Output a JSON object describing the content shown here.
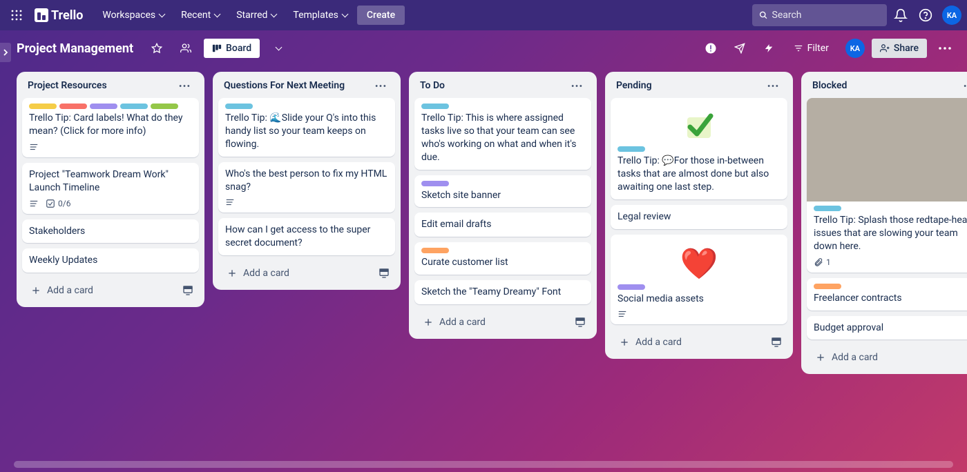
{
  "brand": "Trello",
  "nav": {
    "workspaces": "Workspaces",
    "recent": "Recent",
    "starred": "Starred",
    "templates": "Templates",
    "create": "Create"
  },
  "search_placeholder": "Search",
  "user_initials": "KA",
  "board": {
    "title": "Project Management",
    "view_label": "Board",
    "filter": "Filter",
    "share": "Share"
  },
  "colors": {
    "yellow": "#f5cd47",
    "red": "#f87168",
    "purple": "#9f8fef",
    "sky": "#6cc3e0",
    "lime": "#94c748",
    "orange": "#fea362"
  },
  "lists": [
    {
      "title": "Project Resources",
      "cards": [
        {
          "labels": [
            "yellow",
            "red",
            "purple",
            "sky",
            "lime"
          ],
          "text": "Trello Tip: Card labels! What do they mean? (Click for more info)",
          "badges": {
            "desc": true
          }
        },
        {
          "text": "Project \"Teamwork Dream Work\" Launch Timeline",
          "badges": {
            "desc": true,
            "checklist": "0/6"
          }
        },
        {
          "text": "Stakeholders"
        },
        {
          "text": "Weekly Updates"
        }
      ],
      "add": "Add a card"
    },
    {
      "title": "Questions For Next Meeting",
      "cards": [
        {
          "labels": [
            "sky"
          ],
          "text": "Trello Tip: 🌊Slide your Q's into this handy list so your team keeps on flowing."
        },
        {
          "text": "Who's the best person to fix my HTML snag?",
          "badges": {
            "desc": true
          }
        },
        {
          "text": "How can I get access to the super secret document?"
        }
      ],
      "add": "Add a card"
    },
    {
      "title": "To Do",
      "cards": [
        {
          "labels": [
            "sky"
          ],
          "text": "Trello Tip: This is where assigned tasks live so that your team can see who's working on what and when it's due."
        },
        {
          "labels": [
            "purple"
          ],
          "text": "Sketch site banner"
        },
        {
          "text": "Edit email drafts"
        },
        {
          "labels": [
            "orange"
          ],
          "text": "Curate customer list"
        },
        {
          "text": "Sketch the \"Teamy Dreamy\" Font"
        }
      ],
      "add": "Add a card"
    },
    {
      "title": "Pending",
      "cards": [
        {
          "sticker": "check",
          "labels": [
            "sky"
          ],
          "text": "Trello Tip: 💬For those in-between tasks that are almost done but also awaiting one last step."
        },
        {
          "text": "Legal review"
        },
        {
          "sticker": "heart",
          "labels": [
            "purple"
          ],
          "text": "Social media assets",
          "badges": {
            "desc": true
          }
        }
      ],
      "add": "Add a card"
    },
    {
      "title": "Blocked",
      "cards": [
        {
          "cover_image": true,
          "labels": [
            "sky"
          ],
          "text": "Trello Tip: Splash those redtape-heavy issues that are slowing your team down here.",
          "badges": {
            "attachment": "1"
          }
        },
        {
          "labels": [
            "orange"
          ],
          "text": "Freelancer contracts"
        },
        {
          "text": "Budget approval"
        }
      ],
      "add": "Add a card"
    }
  ]
}
